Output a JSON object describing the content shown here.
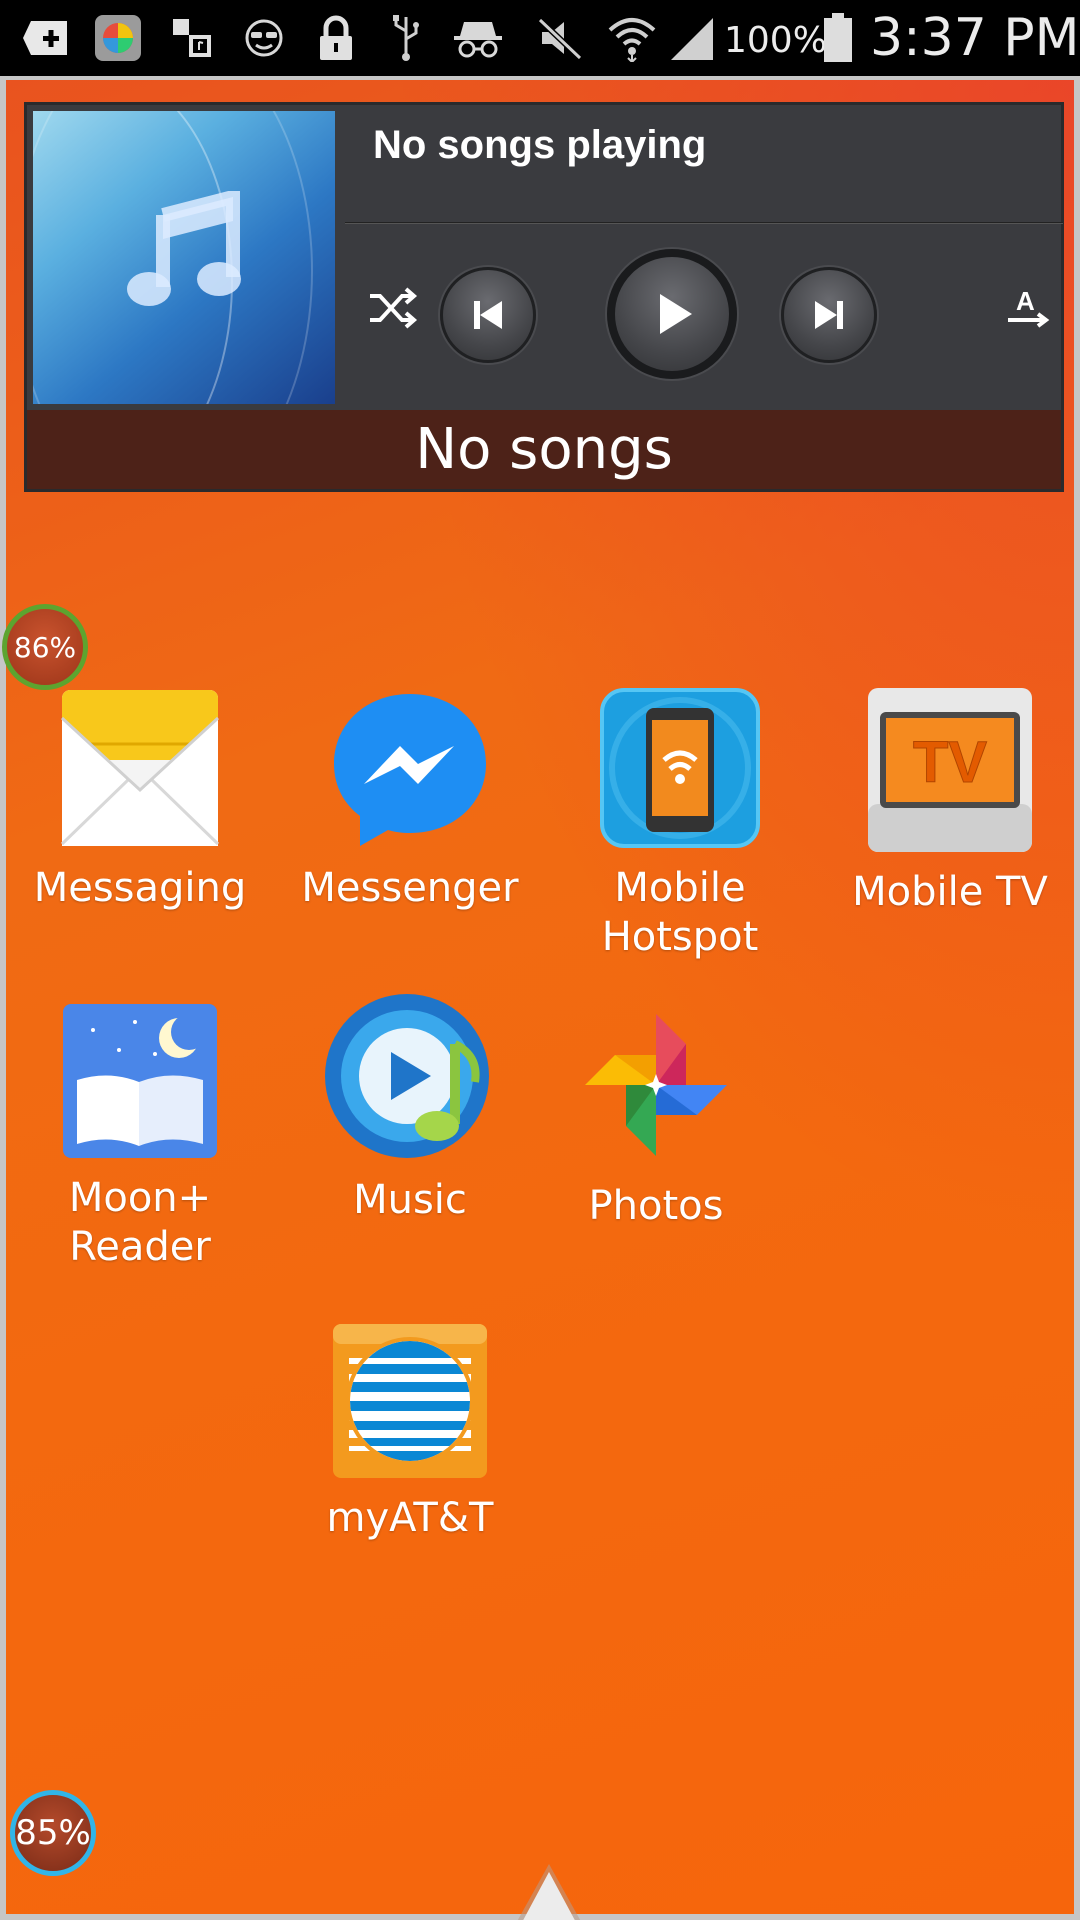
{
  "status_bar": {
    "icons": [
      "add-icon",
      "app-grid-icon",
      "media-notification-icon",
      "face-icon",
      "lock-icon",
      "usb-icon",
      "incognito-icon",
      "mute-icon",
      "wifi-icon",
      "signal-icon",
      "battery-icon"
    ],
    "battery_percent": "100%",
    "clock": "3:37 PM"
  },
  "music_widget": {
    "now_playing_title": "No songs playing",
    "song_bar_text": "No songs",
    "controls": [
      "shuffle-icon",
      "previous-icon",
      "play-icon",
      "next-icon",
      "lyrics-icon"
    ]
  },
  "apps": [
    {
      "label": "Messaging",
      "icon": "messaging-icon"
    },
    {
      "label": "Messenger",
      "icon": "messenger-icon"
    },
    {
      "label": "Mobile\nHotspot",
      "icon": "mobile-hotspot-icon"
    },
    {
      "label": "Mobile TV",
      "icon": "mobile-tv-icon",
      "icon_text": "TV"
    },
    {
      "label": "Moon+\nReader",
      "icon": "moon-reader-icon"
    },
    {
      "label": "Music",
      "icon": "music-icon"
    },
    {
      "label": "Photos",
      "icon": "photos-icon"
    },
    {
      "label": "myAT&T",
      "icon": "att-icon"
    }
  ],
  "badges": {
    "top": "86%",
    "bottom": "85%"
  },
  "colors": {
    "wallpaper": "#f06a14",
    "widget_bg": "#3a3b3f",
    "song_bar": "#4d2218"
  }
}
